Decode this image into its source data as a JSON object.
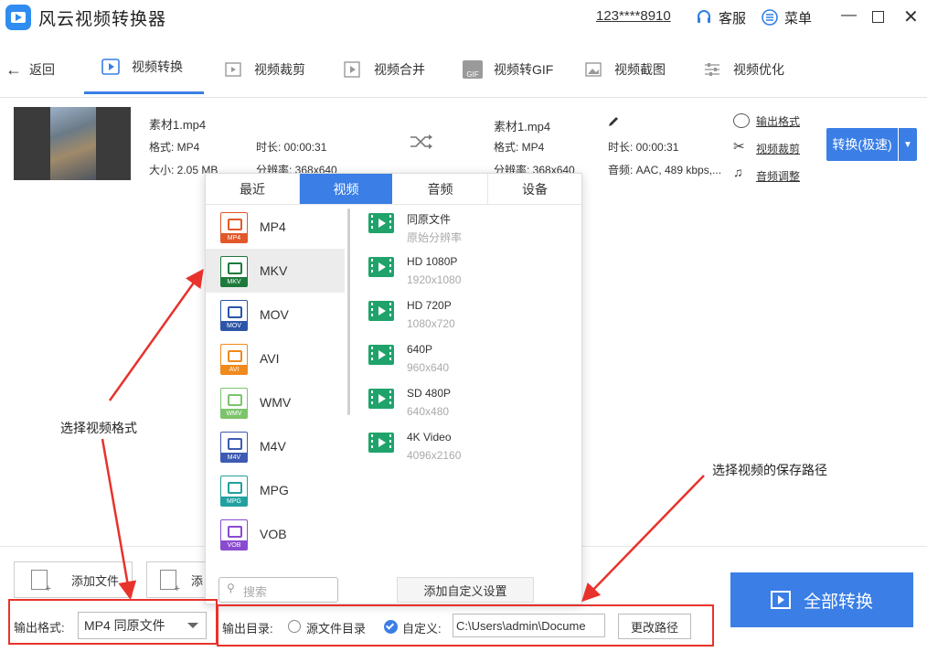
{
  "app": {
    "title": "风云视频转换器",
    "account": "123****8910",
    "service": "客服",
    "menu": "菜单"
  },
  "nav": {
    "back": "返回",
    "tabs": [
      {
        "label": "视频转换"
      },
      {
        "label": "视频裁剪"
      },
      {
        "label": "视频合并"
      },
      {
        "label": "视频转GIF"
      },
      {
        "label": "视频截图"
      },
      {
        "label": "视频优化"
      }
    ],
    "gif_badge": "GIF"
  },
  "file": {
    "src": {
      "name": "素材1.mp4",
      "format": "格式: MP4",
      "duration": "时长: 00:00:31",
      "size": "大小: 2.05 MB",
      "resolution": "分辨率: 368x640"
    },
    "dst": {
      "name": "素材1.mp4",
      "format": "格式: MP4",
      "duration": "时长: 00:00:31",
      "resolution": "分辨率: 368x640",
      "audio": "音频: AAC, 489 kbps,..."
    },
    "links": {
      "output_format": "输出格式",
      "crop": "视频裁剪",
      "audio": "音频调整"
    },
    "convert": "转换(极速)"
  },
  "popup": {
    "tabs": [
      "最近",
      "视频",
      "音频",
      "设备"
    ],
    "formats": [
      {
        "name": "MP4",
        "badge": "MP4",
        "color": "#e2582b"
      },
      {
        "name": "MKV",
        "badge": "MKV",
        "color": "#1e7a3c"
      },
      {
        "name": "MOV",
        "badge": "MOV",
        "color": "#2c55a8"
      },
      {
        "name": "AVI",
        "badge": "AVI",
        "color": "#f08a1c"
      },
      {
        "name": "WMV",
        "badge": "WMV",
        "color": "#7cc46c"
      },
      {
        "name": "M4V",
        "badge": "M4V",
        "color": "#3d5bb2"
      },
      {
        "name": "MPG",
        "badge": "MPG",
        "color": "#22a0a0"
      },
      {
        "name": "VOB",
        "badge": "VOB",
        "color": "#8a4bd1"
      }
    ],
    "resolutions": [
      {
        "name": "同原文件",
        "sub": "原始分辨率"
      },
      {
        "name": "HD 1080P",
        "sub": "1920x1080"
      },
      {
        "name": "HD 720P",
        "sub": "1080x720"
      },
      {
        "name": "640P",
        "sub": "960x640"
      },
      {
        "name": "SD 480P",
        "sub": "640x480"
      },
      {
        "name": "4K Video",
        "sub": "4096x2160"
      }
    ],
    "search_placeholder": "搜索",
    "add_custom": "添加自定义设置"
  },
  "bottom": {
    "add_file": "添加文件",
    "add_folder": "添",
    "output_format_label": "输出格式:",
    "output_format_value": "MP4 同原文件",
    "output_dir_label": "输出目录:",
    "source_dir": "源文件目录",
    "custom": "自定义:",
    "path": "C:\\Users\\admin\\Docume",
    "change_path": "更改路径",
    "convert_all": "全部转换"
  },
  "annotations": {
    "choose_format": "选择视频格式",
    "choose_path": "选择视频的保存路径"
  },
  "colors": {
    "accent": "#3a7ee6",
    "annotation_red": "#e8322c",
    "film_green": "#1fa36b"
  }
}
